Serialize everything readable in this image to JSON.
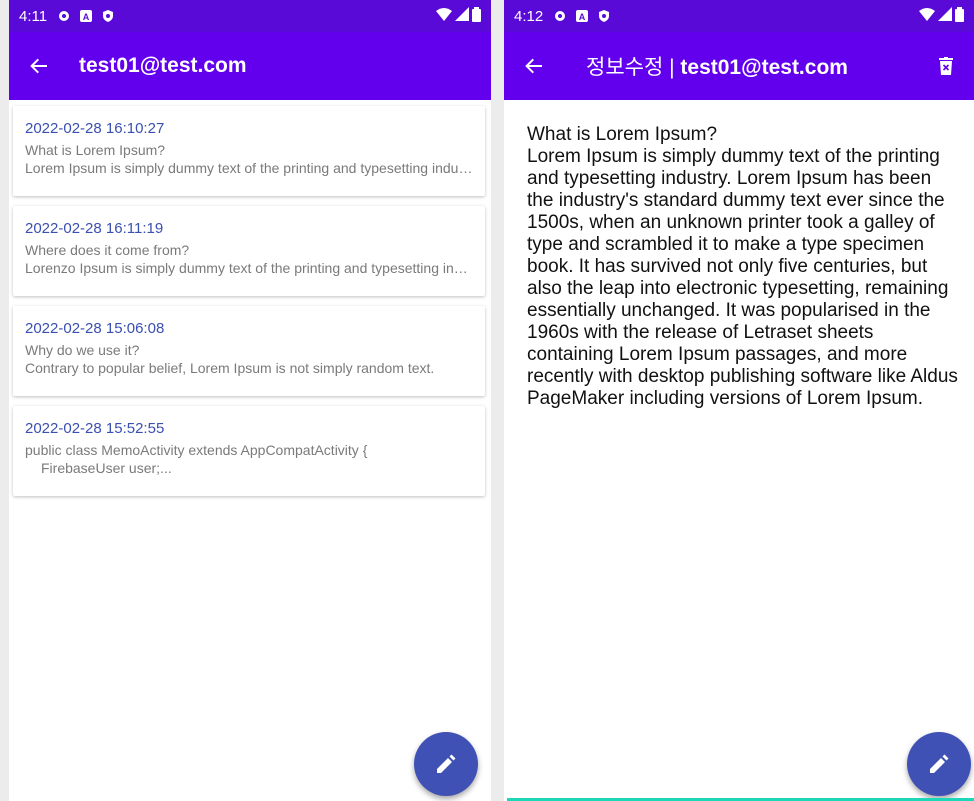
{
  "left_screen": {
    "status": {
      "time": "4:11"
    },
    "header": {
      "title": "test01@test.com"
    },
    "memos": [
      {
        "date": "2022-02-28 16:10:27",
        "line1": "What is Lorem Ipsum?",
        "line2": "Lorem Ipsum is simply dummy text of the printing and typesetting industry."
      },
      {
        "date": "2022-02-28 16:11:19",
        "line1": "Where does it come from?",
        "line2": "Lorenzo Ipsum is simply dummy text of the printing and typesetting industry."
      },
      {
        "date": "2022-02-28 15:06:08",
        "line1": "Why do we use it?",
        "line2": "Contrary to popular belief, Lorem Ipsum is not simply random text."
      },
      {
        "date": "2022-02-28 15:52:55",
        "line1": "public class MemoActivity extends AppCompatActivity {",
        "line2": "FirebaseUser user;..."
      }
    ]
  },
  "right_screen": {
    "status": {
      "time": "4:12"
    },
    "header": {
      "title_prefix": "정보수정 | ",
      "title_email": "test01@test.com"
    },
    "memo": {
      "heading": "What is Lorem Ipsum?",
      "body": "Lorem Ipsum is simply dummy text of the printing and typesetting industry. Lorem Ipsum has been the industry's standard dummy text ever since the 1500s, when an unknown printer took a galley of type and scrambled it to make a type specimen book. It has survived not only five centuries, but also the leap into electronic typesetting, remaining essentially unchanged. It was popularised in the 1960s with the release of Letraset sheets containing Lorem Ipsum passages, and more recently with desktop publishing software like Aldus PageMaker including versions of Lorem Ipsum."
    }
  },
  "icons": {
    "back": "arrow-back-icon",
    "edit": "pencil-icon",
    "delete": "trash-icon",
    "settings": "gear-icon",
    "wifi": "wifi-icon",
    "signal": "signal-icon",
    "battery": "battery-icon"
  },
  "colors": {
    "status_bar": "#5a0ad6",
    "app_bar": "#6200ee",
    "fab": "#3f51b5",
    "date_text": "#3a4fb0",
    "accent_line": "#1ed7b8"
  }
}
